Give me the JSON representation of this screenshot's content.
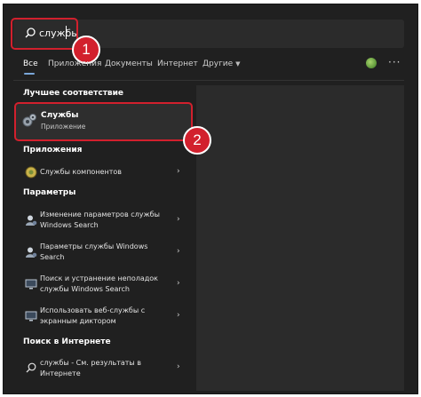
{
  "search": {
    "query": "службы"
  },
  "badges": {
    "one": "1",
    "two": "2"
  },
  "tabs": {
    "all": "Все",
    "apps": "Приложения",
    "docs": "Документы",
    "web": "Интернет",
    "other": "Другие"
  },
  "sections": {
    "best_match": "Лучшее соответствие",
    "apps": "Приложения",
    "settings": "Параметры",
    "web_search": "Поиск в Интернете"
  },
  "best_match": {
    "title": "Службы",
    "subtitle": "Приложение"
  },
  "apps": [
    {
      "label": "Службы компонентов"
    }
  ],
  "settings": [
    {
      "line1": "Изменение параметров службы",
      "line2": "Windows Search"
    },
    {
      "line1": "Параметры службы Windows",
      "line2": "Search"
    },
    {
      "line1": "Поиск и устранение неполадок",
      "line2": "службы Windows Search"
    },
    {
      "line1": "Использовать веб-службы с",
      "line2": "экранным диктором"
    }
  ],
  "web": {
    "line1": "службы - См. результаты в",
    "line2": "Интернете"
  },
  "colors": {
    "highlight": "#d2202d",
    "background": "#202020",
    "accent": "#7aa7d9"
  },
  "icons": [
    "search-icon",
    "gear-icon",
    "components-icon",
    "user-settings-icon",
    "monitor-icon",
    "chevron-right-icon"
  ]
}
